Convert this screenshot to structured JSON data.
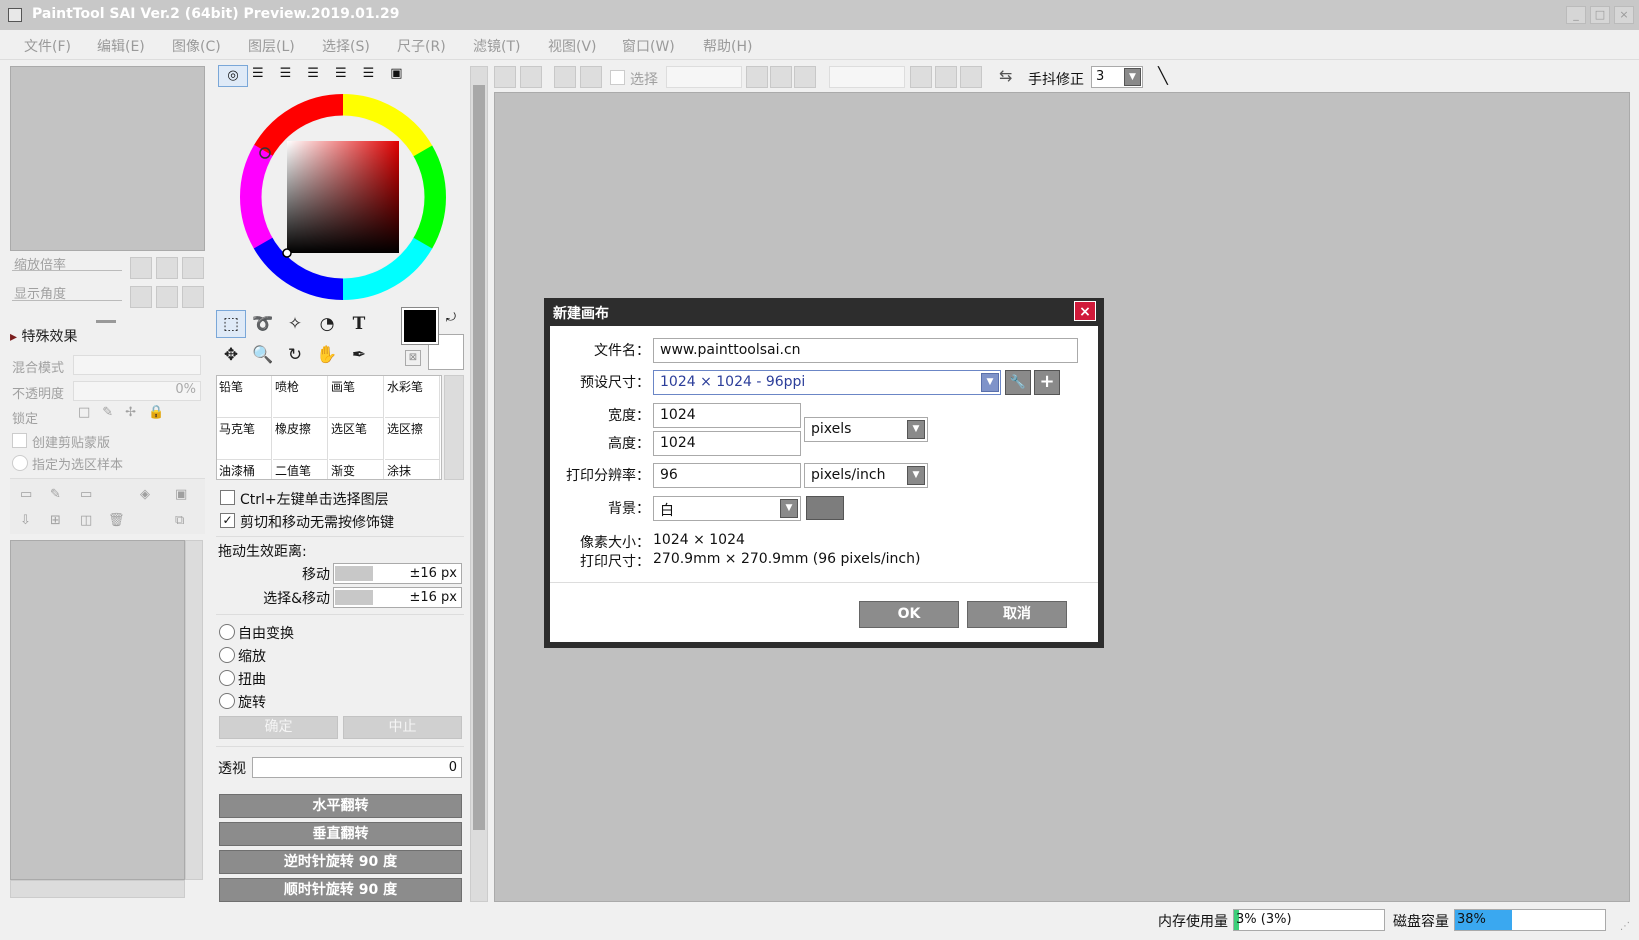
{
  "window": {
    "title": "PaintTool SAI Ver.2 (64bit) Preview.2019.01.29",
    "controls": [
      "_",
      "□",
      "×"
    ]
  },
  "menu": [
    "文件(F)",
    "编辑(E)",
    "图像(C)",
    "图层(L)",
    "选择(S)",
    "尺子(R)",
    "滤镜(T)",
    "视图(V)",
    "窗口(W)",
    "帮助(H)"
  ],
  "navigator": {
    "zoom_label": "缩放倍率",
    "angle_label": "显示角度"
  },
  "layer_panel": {
    "effects_label": "特殊效果",
    "blend_label": "混合模式",
    "opacity_label": "不透明度",
    "opacity_value": "0%",
    "lock_label": "锁定",
    "clip_label": "创建剪贴蒙版",
    "sample_label": "指定为选区样本"
  },
  "brushes": [
    [
      "铅笔",
      "喷枪",
      "画笔",
      "水彩笔"
    ],
    [
      "马克笔",
      "橡皮擦",
      "选区笔",
      "选区擦"
    ],
    [
      "油漆桶",
      "二值笔",
      "渐变",
      "涂抹"
    ]
  ],
  "tool_options": {
    "ctrl_click_label": "Ctrl+左键单击选择图层",
    "cut_move_label": "剪切和移动无需按修饰键",
    "drag_label": "拖动生效距离:",
    "move_label": "移动",
    "move_value": "±16 px",
    "select_move_label": "选择&移动",
    "select_move_value": "±16 px",
    "free_transform": "自由变换",
    "scale": "缩放",
    "distort": "扭曲",
    "rotate": "旋转",
    "confirm": "确定",
    "abort": "中止",
    "perspective_label": "透视",
    "perspective_value": "0",
    "flip_h": "水平翻转",
    "flip_v": "垂直翻转",
    "rot_ccw": "逆时针旋转 90 度",
    "rot_cw": "顺时针旋转 90 度"
  },
  "toolbar": {
    "select_label": "选择",
    "stabilizer_label": "手抖修正",
    "stabilizer_value": "3"
  },
  "dialog": {
    "title": "新建画布",
    "filename_label": "文件名：",
    "filename_value": "www.painttoolsai.cn",
    "preset_label": "预设尺寸：",
    "preset_value": "1024 × 1024 - 96ppi",
    "width_label": "宽度：",
    "width_value": "1024",
    "height_label": "高度：",
    "height_value": "1024",
    "unit_value": "pixels",
    "dpi_label": "打印分辨率：",
    "dpi_value": "96",
    "dpi_unit": "pixels/inch",
    "bg_label": "背景：",
    "bg_value": "白",
    "pixel_size_label": "像素大小：",
    "pixel_size_value": "1024 × 1024",
    "print_size_label": "打印尺寸：",
    "print_size_value": "270.9mm × 270.9mm (96 pixels/inch)",
    "ok": "OK",
    "cancel": "取消"
  },
  "status": {
    "mem_label": "内存使用量",
    "mem_value": "3% (3%)",
    "mem_fraction": 0.03,
    "disk_label": "磁盘容量",
    "disk_value": "38%",
    "disk_fraction": 0.38
  },
  "colors": {
    "accent_close": "#d01a3a",
    "primary_color": "#000000",
    "secondary_color": "#ffffff",
    "disk_bar": "#3aa8f0"
  }
}
